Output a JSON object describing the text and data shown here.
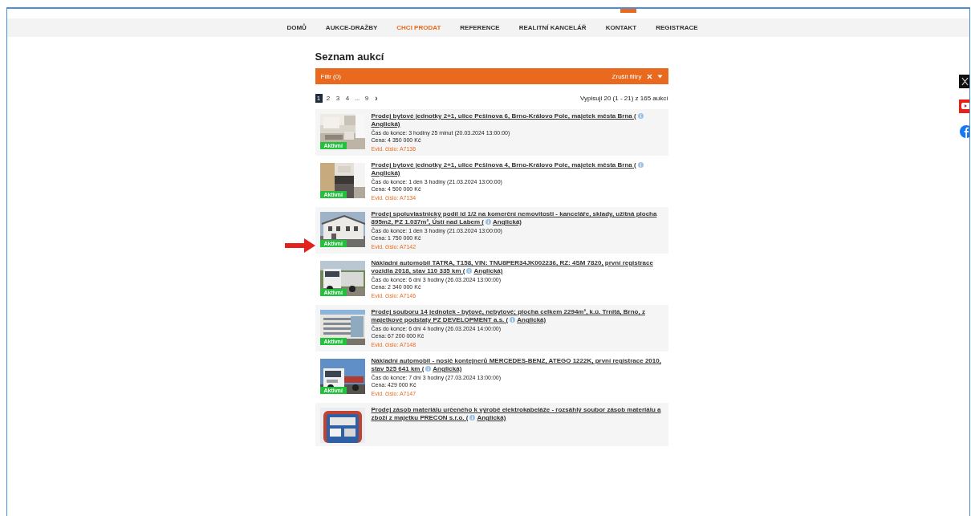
{
  "header": {
    "tab": {
      "kind": "accent"
    }
  },
  "nav": [
    {
      "label": "DOMŮ",
      "selected": false
    },
    {
      "label": "AUKCE-DRAŽBY",
      "selected": false
    },
    {
      "label": "CHCI PRODAT",
      "selected": true
    },
    {
      "label": "REFERENCE",
      "selected": false
    },
    {
      "label": "REALITNÍ KANCELÁŘ",
      "selected": false
    },
    {
      "label": "KONTAKT",
      "selected": false
    },
    {
      "label": "REGISTRACE",
      "selected": false
    }
  ],
  "page_title": "Seznam aukcí",
  "filter": {
    "label": "Filtr (0)",
    "clear": "Zrušit filtry",
    "expanded": false
  },
  "pagination": {
    "pages": [
      {
        "label": "1",
        "selected": true
      },
      {
        "label": "2",
        "selected": false
      },
      {
        "label": "3",
        "selected": false
      },
      {
        "label": "4",
        "selected": false
      },
      {
        "label": "...",
        "selected": false
      },
      {
        "label": "9",
        "selected": false
      }
    ],
    "next": "›",
    "summary": "Vypisuji 20 (1 - 21) z 165 aukcí"
  },
  "auctions": [
    {
      "title": "Prodej bytové jednotky 2+1, ulice Pešinova 6, Brno-Královo Pole, majetek města Brna (",
      "lang": "Anglická)",
      "time": "Čas do konce: 3 hodiny 25 minut (20.03.2024 13:00:00)",
      "price": "Cena: 4 350 000 Kč",
      "ref": "Evid. číslo: A7136",
      "badge": "Aktivní"
    },
    {
      "title": "Prodej bytové jednotky 2+1, ulice Pešinova 4, Brno-Královo Pole, majetek města Brna (",
      "lang": "Anglická)",
      "time": "Čas do konce: 1 den 3 hodiny (21.03.2024 13:00:00)",
      "price": "Cena: 4 500 000 Kč",
      "ref": "Evid. číslo: A7134",
      "badge": "Aktivní"
    },
    {
      "title": "Prodej spoluvlastnický podíl id 1/2 na komerční nemovitosti - kanceláře, sklady, užitná plocha 895m2, PZ 1.037m², Ústí nad Labem (",
      "lang": "Anglická)",
      "time": "Čas do konce: 1 den 3 hodiny (21.03.2024 13:00:00)",
      "price": "Cena: 1 750 000 Kč",
      "ref": "Evid. číslo: A7142",
      "badge": "Aktivní"
    },
    {
      "title": "Nákladní automobil TATRA, T158, VIN: TNU8PER34JK002236, RZ: 4SM 7820, první registrace vozidla 2018, stav 110 335 km (",
      "lang": "Anglická)",
      "time": "Čas do konce: 6 dní 3 hodiny (26.03.2024 13:00:00)",
      "price": "Cena: 2 340 000 Kč",
      "ref": "Evid. číslo: A7146",
      "badge": "Aktivní"
    },
    {
      "title": "Prodej souboru 14 jednotek - bytové, nebytové; plocha celkem 2294m², k.ú. Trnitá, Brno, z majetkové podstaty PZ DEVELOPMENT a.s. (",
      "lang": "Anglická)",
      "time": "Čas do konce: 6 dní 4 hodiny (26.03.2024 14:00:00)",
      "price": "Cena: 67 200 000 Kč",
      "ref": "Evid. číslo: A7148",
      "badge": "Aktivní"
    },
    {
      "title": "Nákladní automobil - nosič kontejnerů MERCEDES-BENZ, ATEGO 1222K, první registrace 2010, stav 525 641 km (",
      "lang": "Anglická)",
      "time": "Čas do konce: 7 dní 3 hodiny (27.03.2024 13:00:00)",
      "price": "Cena: 429 000 Kč",
      "ref": "Evid. číslo: A7147",
      "badge": "Aktivní"
    },
    {
      "title": "Prodej zásob materiálu určeného k výrobě elektrokabeláže - rozsáhlý soubor zásob materiálu a zboží z majetku PRECON s.r.o. (",
      "lang": "Anglická)"
    }
  ],
  "social_links": [
    {
      "kind": "x"
    },
    {
      "kind": "youtube"
    },
    {
      "kind": "facebook"
    }
  ]
}
